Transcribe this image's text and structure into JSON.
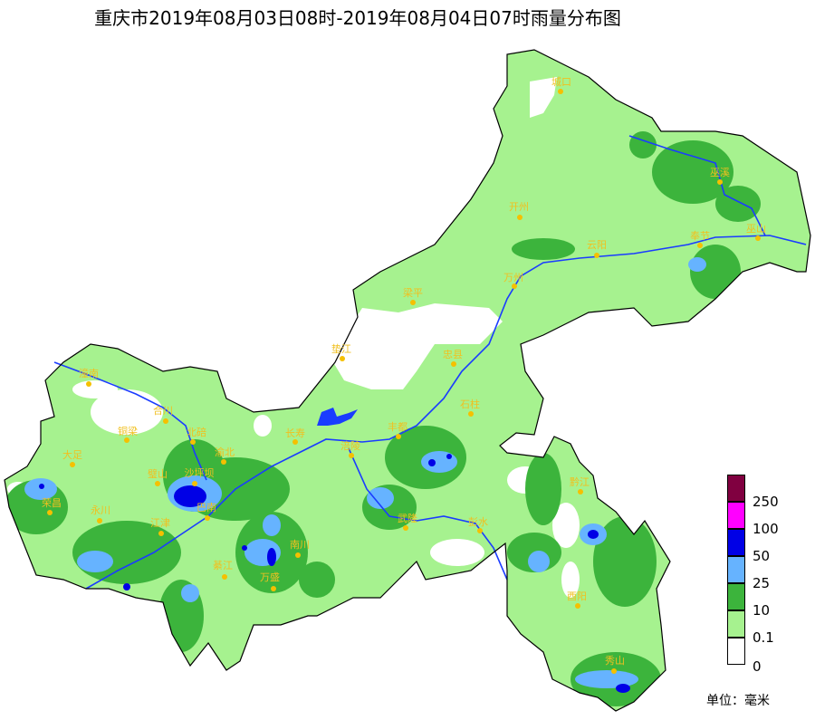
{
  "title": "重庆市2019年08月03日08时-2019年08月04日07时雨量分布图",
  "legend": {
    "levels": [
      {
        "label": "250",
        "color": "#800040"
      },
      {
        "label": "100",
        "color": "#ff00ff"
      },
      {
        "label": "50",
        "color": "#0000e6"
      },
      {
        "label": "25",
        "color": "#66b3ff"
      },
      {
        "label": "10",
        "color": "#3cb43c"
      },
      {
        "label": "0.1",
        "color": "#a6f28f"
      },
      {
        "label": "0",
        "color": "#ffffff"
      }
    ],
    "unit": "单位：毫米"
  },
  "colors": {
    "river": "#1a3cff",
    "boundary": "#000000",
    "district": "#c0c0c0",
    "city": "#f0c020"
  },
  "cities": [
    "城口",
    "开州",
    "巫溪",
    "云阳",
    "奉节",
    "巫山",
    "万州",
    "梁平",
    "垫江",
    "忠县",
    "石柱",
    "潼南",
    "合川",
    "铜梁",
    "大足",
    "北碚",
    "渝北",
    "长寿",
    "璧山",
    "沙坪坝",
    "巴南",
    "荣昌",
    "永川",
    "江津",
    "綦江",
    "万盛",
    "南川",
    "涪陵",
    "丰都",
    "武隆",
    "彭水",
    "黔江",
    "酉阳",
    "秀山"
  ]
}
